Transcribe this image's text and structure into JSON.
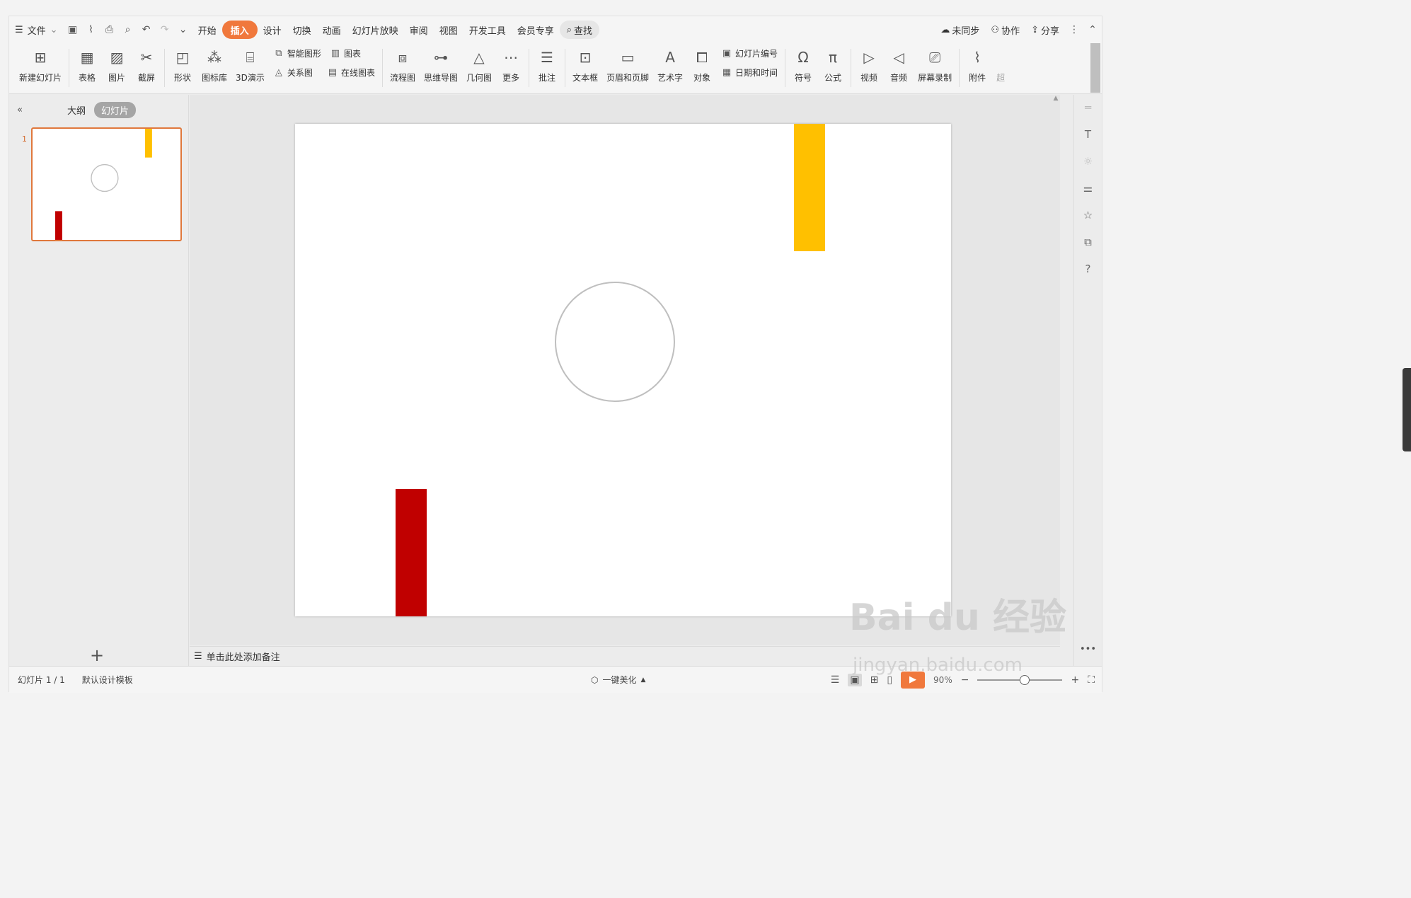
{
  "menubar": {
    "file": "文件",
    "tabs": [
      "开始",
      "插入",
      "设计",
      "切换",
      "动画",
      "幻灯片放映",
      "审阅",
      "视图",
      "开发工具",
      "会员专享"
    ],
    "active_tab": "插入",
    "search": "查找",
    "sync": "未同步",
    "collab": "协作",
    "share": "分享"
  },
  "ribbon": {
    "new_slide": "新建幻灯片",
    "table": "表格",
    "picture": "图片",
    "screenshot": "截屏",
    "shape": "形状",
    "icon_lib": "图标库",
    "demo3d": "3D演示",
    "smart_art": "智能图形",
    "chart": "图表",
    "relation": "关系图",
    "online_chart": "在线图表",
    "flowchart": "流程图",
    "mindmap": "思维导图",
    "geometry": "几何图",
    "more": "更多",
    "comment": "批注",
    "textbox": "文本框",
    "header_footer": "页眉和页脚",
    "wordart": "艺术字",
    "object": "对象",
    "slide_number": "幻灯片编号",
    "date_time": "日期和时间",
    "symbol": "符号",
    "formula": "公式",
    "video": "视频",
    "audio": "音频",
    "screen_record": "屏幕录制",
    "attachment": "附件",
    "hyperlink": "超"
  },
  "left_panel": {
    "tab_outline": "大纲",
    "tab_slides": "幻灯片",
    "slide_number": "1"
  },
  "slide": {
    "yellow": "#ffc000",
    "red": "#c00000",
    "circle_stroke": "#bfbfbf"
  },
  "notes": {
    "placeholder": "单击此处添加备注"
  },
  "status": {
    "slide_info": "幻灯片 1 / 1",
    "template": "默认设计模板",
    "beautify": "一键美化",
    "zoom": "90%"
  },
  "watermark": {
    "line1": "Bai du 经验",
    "line2": "jingyan.baidu.com"
  }
}
